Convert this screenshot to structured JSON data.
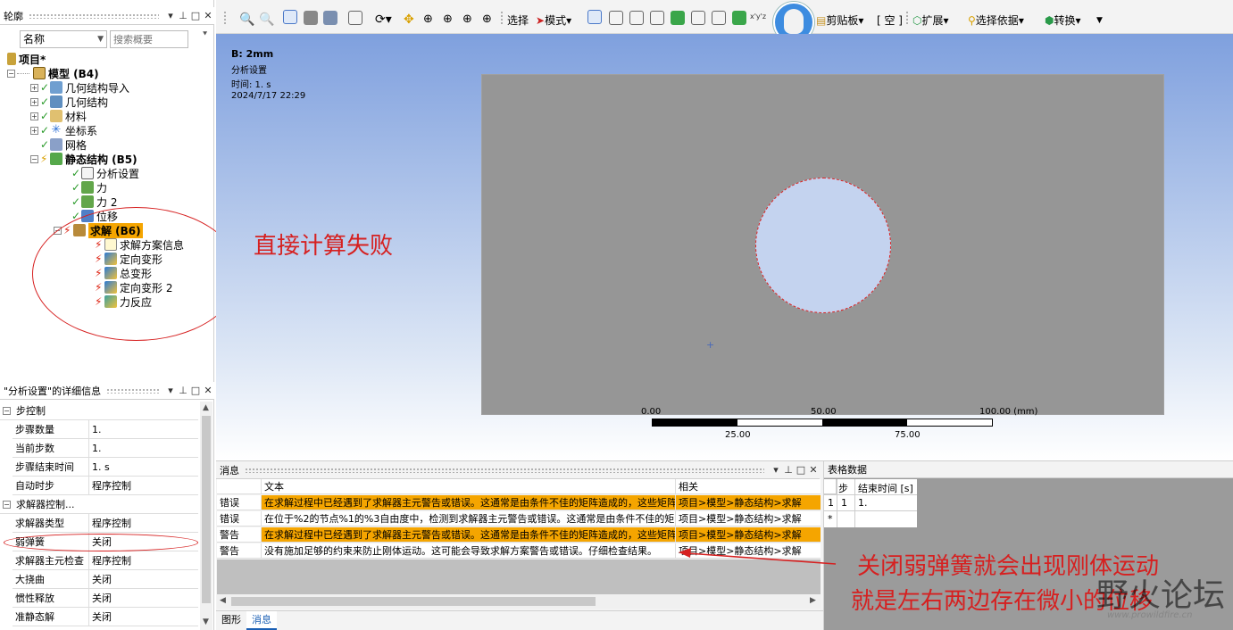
{
  "outline": {
    "title": "轮廓",
    "name_filter": "名称",
    "search_placeholder": "搜索概要",
    "tree": [
      {
        "label": "项目*"
      },
      {
        "label": "模型 (B4)"
      },
      {
        "label": "几何结构导入"
      },
      {
        "label": "几何结构"
      },
      {
        "label": "材料"
      },
      {
        "label": "坐标系"
      },
      {
        "label": "网格"
      },
      {
        "label": "静态结构 (B5)"
      },
      {
        "label": "分析设置"
      },
      {
        "label": "力"
      },
      {
        "label": "力 2"
      },
      {
        "label": "位移"
      },
      {
        "label": "求解 (B6)"
      },
      {
        "label": "求解方案信息"
      },
      {
        "label": "定向变形"
      },
      {
        "label": "总变形"
      },
      {
        "label": "定向变形 2"
      },
      {
        "label": "力反应"
      }
    ]
  },
  "annotations": {
    "fail_note": "直接计算失败",
    "spring_note_line1": "关闭弱弹簧就会出现刚体运动",
    "spring_note_line2": "就是左右两边存在微小的位移",
    "watermark": "野火论坛",
    "watermark_url": "www.prowildfire.cn"
  },
  "details": {
    "title": "\"分析设置\"的详细信息",
    "sections": [
      {
        "label": "步控制"
      },
      {
        "label": "求解器控制..."
      }
    ],
    "rows": [
      {
        "key": "步骤数量",
        "value": "1."
      },
      {
        "key": "当前步数",
        "value": "1."
      },
      {
        "key": "步骤结束时间",
        "value": "1. s"
      },
      {
        "key": "自动时步",
        "value": "程序控制"
      },
      {
        "key": "求解器类型",
        "value": "程序控制"
      },
      {
        "key": "弱弹簧",
        "value": "关闭"
      },
      {
        "key": "求解器主元检查",
        "value": "程序控制"
      },
      {
        "key": "大挠曲",
        "value": "关闭"
      },
      {
        "key": "惯性释放",
        "value": "关闭"
      },
      {
        "key": "准静态解",
        "value": "关闭"
      }
    ]
  },
  "toolbar": {
    "select": "选择",
    "mode": "模式",
    "clipboard": "剪贴板",
    "empty": "[ 空 ]",
    "extend": "扩展",
    "select_by": "选择依据",
    "convert": "转换"
  },
  "viewport": {
    "name": "B: 2mm",
    "subtitle": "分析设置",
    "time": "时间: 1. s",
    "date": "2024/7/17 22:29",
    "scale_labels_top": [
      "0.00",
      "50.00",
      "100.00 (mm)"
    ],
    "scale_labels_bottom": [
      "25.00",
      "75.00"
    ]
  },
  "messages": {
    "title": "消息",
    "col_text": "文本",
    "col_related": "相关",
    "rows": [
      {
        "type": "错误",
        "text": "在求解过程中已经遇到了求解器主元警告或错误。这通常是由条件不佳的矩阵造成的，这些矩阵",
        "related": "项目>模型>静态结构>求解"
      },
      {
        "type": "错误",
        "text": "在位于%2的节点%1的%3自由度中，检测到求解器主元警告或错误。这通常是由条件不佳的矩",
        "related": "项目>模型>静态结构>求解"
      },
      {
        "type": "警告",
        "text": "在求解过程中已经遇到了求解器主元警告或错误。这通常是由条件不佳的矩阵造成的，这些矩阵",
        "related": "项目>模型>静态结构>求解"
      },
      {
        "type": "警告",
        "text": "没有施加足够的约束来防止刚体运动。这可能会导致求解方案警告或错误。仔细检查结果。",
        "related": "项目>模型>静态结构>求解"
      }
    ],
    "tab_graph": "图形",
    "tab_messages": "消息"
  },
  "table_data": {
    "title": "表格数据",
    "col_step": "步",
    "col_end_time": "结束时间 [s]",
    "row_index": "1",
    "row_step": "1",
    "row_end_time": "1.",
    "new_row": "*"
  }
}
